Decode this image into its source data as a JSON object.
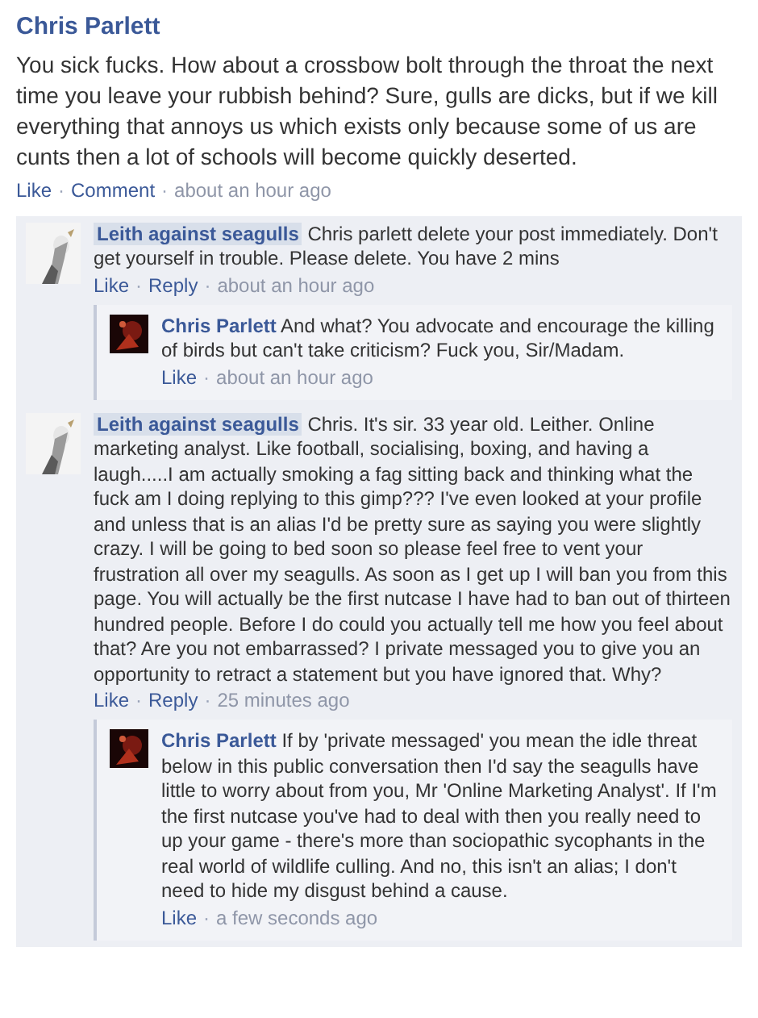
{
  "separator": "·",
  "post": {
    "author": "Chris Parlett",
    "text": "You sick fucks. How about a crossbow bolt through the throat the next time you leave your rubbish behind? Sure, gulls are dicks, but if we kill everything that annoys us which exists only because some of us are cunts then a lot of schools will become quickly deserted.",
    "actions": [
      "Like",
      "Comment"
    ],
    "time": "about an hour ago"
  },
  "comments": [
    {
      "author": "Leith against seagulls",
      "highlighted": true,
      "text": "Chris parlett delete your post immediately. Don't get yourself in trouble. Please delete. You have 2 mins",
      "actions": [
        "Like",
        "Reply"
      ],
      "time": "about an hour ago",
      "replies": [
        {
          "author": "Chris Parlett",
          "highlighted": false,
          "text": "And what? You advocate and encourage the killing of birds but can't take criticism? Fuck you, Sir/Madam.",
          "actions": [
            "Like"
          ],
          "time": "about an hour ago"
        }
      ]
    },
    {
      "author": "Leith against seagulls",
      "highlighted": true,
      "text": "Chris. It's sir. 33 year old. Leither. Online marketing analyst. Like football, socialising, boxing, and having a laugh.....I am actually smoking a fag sitting back and thinking what the fuck am I doing replying to this gimp??? I've even looked at your profile and unless that is an alias I'd be pretty sure as saying you were slightly crazy. I will be going to bed soon so please feel free to vent your frustration all over my seagulls. As soon as I get up I will ban you from this page. You will actually be the first nutcase I have had to ban out of thirteen hundred people. Before I do could you actually tell me how you feel about that? Are you not embarrassed? I private messaged you to give you an opportunity to retract a statement but you have ignored that. Why?",
      "actions": [
        "Like",
        "Reply"
      ],
      "time": "25 minutes ago",
      "replies": [
        {
          "author": "Chris Parlett",
          "highlighted": false,
          "text": "If by 'private messaged' you mean the idle threat below in this public conversation then I'd say the seagulls have little to worry about from you, Mr 'Online Marketing Analyst'. If I'm the first nutcase you've had to deal with then you really need to up your game - there's more than sociopathic sycophants in the real world of wildlife culling. And no, this isn't an alias; I don't need to hide my disgust behind a cause.",
          "actions": [
            "Like"
          ],
          "time": "a few seconds ago"
        }
      ]
    }
  ]
}
